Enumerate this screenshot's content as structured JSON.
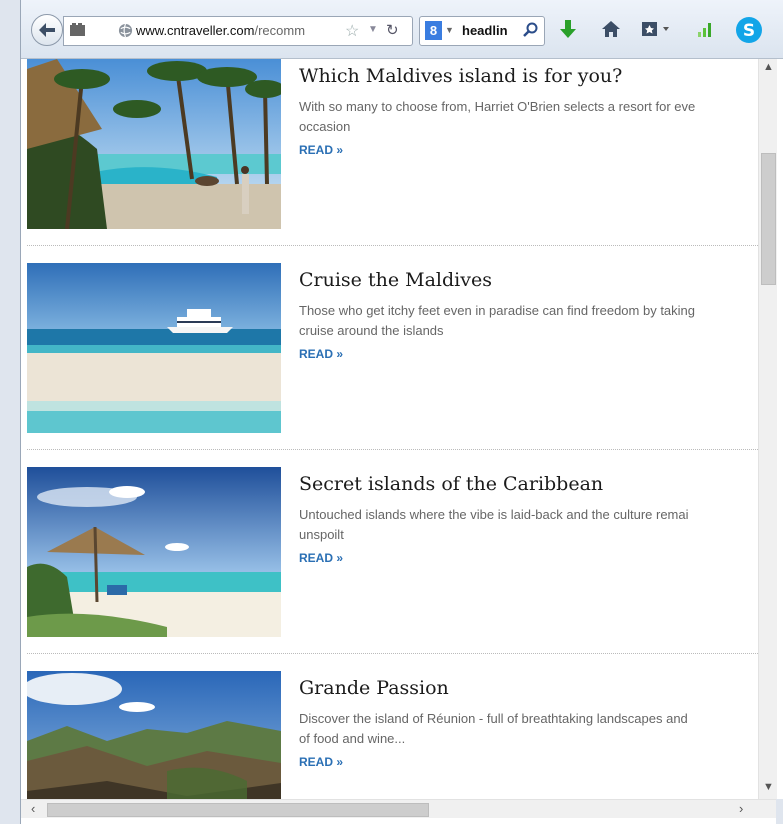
{
  "browser": {
    "url_domain": "www.cntraveller.com",
    "url_path": "/recomm",
    "search_engine_icon": "8",
    "search_query": "headlin"
  },
  "articles": [
    {
      "title": "Which Maldives island is for you?",
      "description_line1": "With so many to choose from, Harriet O'Brien selects a resort for eve",
      "description_line2": "occasion",
      "read_label": "READ »"
    },
    {
      "title": "Cruise the Maldives",
      "description_line1": "Those who get itchy feet even in paradise can find freedom by taking",
      "description_line2": "cruise around the islands",
      "read_label": "READ »"
    },
    {
      "title": "Secret islands of the Caribbean",
      "description_line1": "Untouched islands where the vibe is laid-back and the culture remai",
      "description_line2": "unspoilt",
      "read_label": "READ »"
    },
    {
      "title": "Grande Passion",
      "description_line1": "Discover the island of Réunion - full of breathtaking landscapes and",
      "description_line2": "of food and wine...",
      "read_label": "READ »"
    }
  ],
  "colors": {
    "link": "#2a6fb4",
    "title": "#1b1b1b",
    "description": "#666666"
  }
}
